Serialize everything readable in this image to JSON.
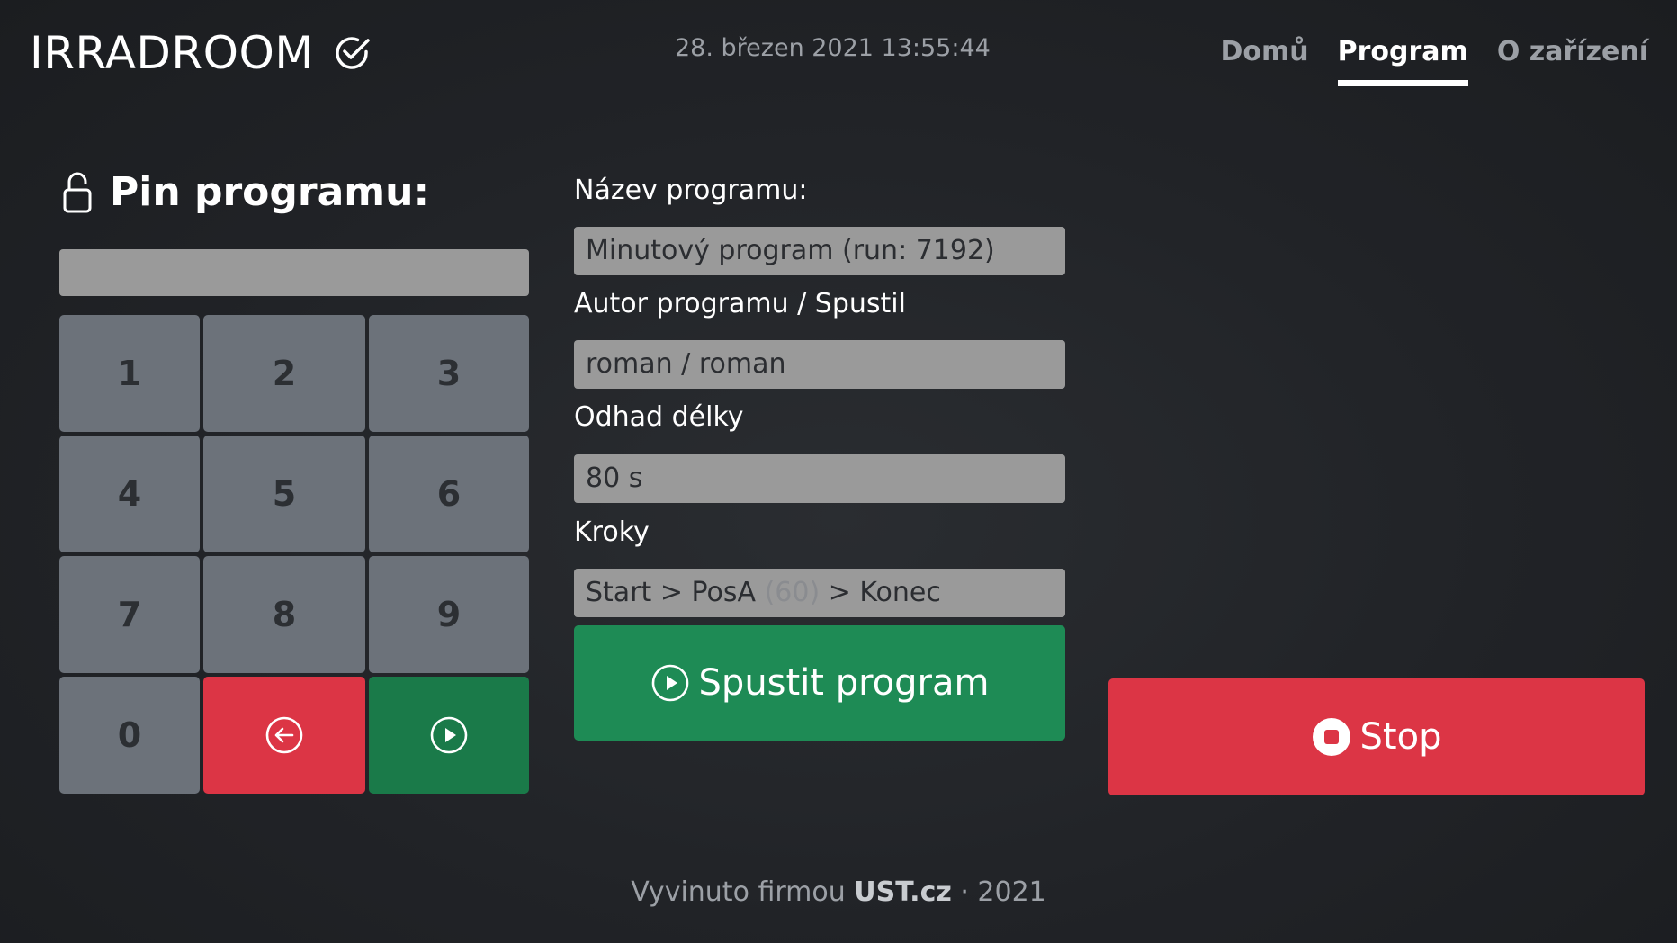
{
  "header": {
    "brand": "IRRADROOM",
    "datetime": "28. březen 2021 13:55:44",
    "nav": [
      {
        "label": "Domů",
        "active": false
      },
      {
        "label": "Program",
        "active": true
      },
      {
        "label": "O zařízení",
        "active": false
      }
    ]
  },
  "pin": {
    "title": "Pin programu:",
    "value": "",
    "keys": [
      "1",
      "2",
      "3",
      "4",
      "5",
      "6",
      "7",
      "8",
      "9",
      "0"
    ],
    "backspace_icon": "arrow-left-circle-icon",
    "submit_icon": "play-circle-icon"
  },
  "program": {
    "name_label": "Název programu:",
    "name_value": "Minutový program (run: 7192)",
    "author_label": "Autor programu / Spustil",
    "author_value": "roman / roman",
    "duration_label": "Odhad délky",
    "duration_value": "80 s",
    "steps_label": "Kroky",
    "steps": {
      "prefix": "Start > PosA ",
      "muted": "(60)",
      "suffix": " > Konec"
    },
    "run_label": "Spustit program",
    "run_icon": "play-circle-icon"
  },
  "stop": {
    "label": "Stop",
    "icon": "stop-circle-icon"
  },
  "footer": {
    "prefix": "Vyvinuto firmou ",
    "company": "UST.cz",
    "suffix": " · 2021"
  },
  "colors": {
    "background": "#212327",
    "danger": "#dc3545",
    "success": "#1e8b55",
    "key_gray": "#6c727a",
    "field_gray": "#9a9a9a"
  }
}
